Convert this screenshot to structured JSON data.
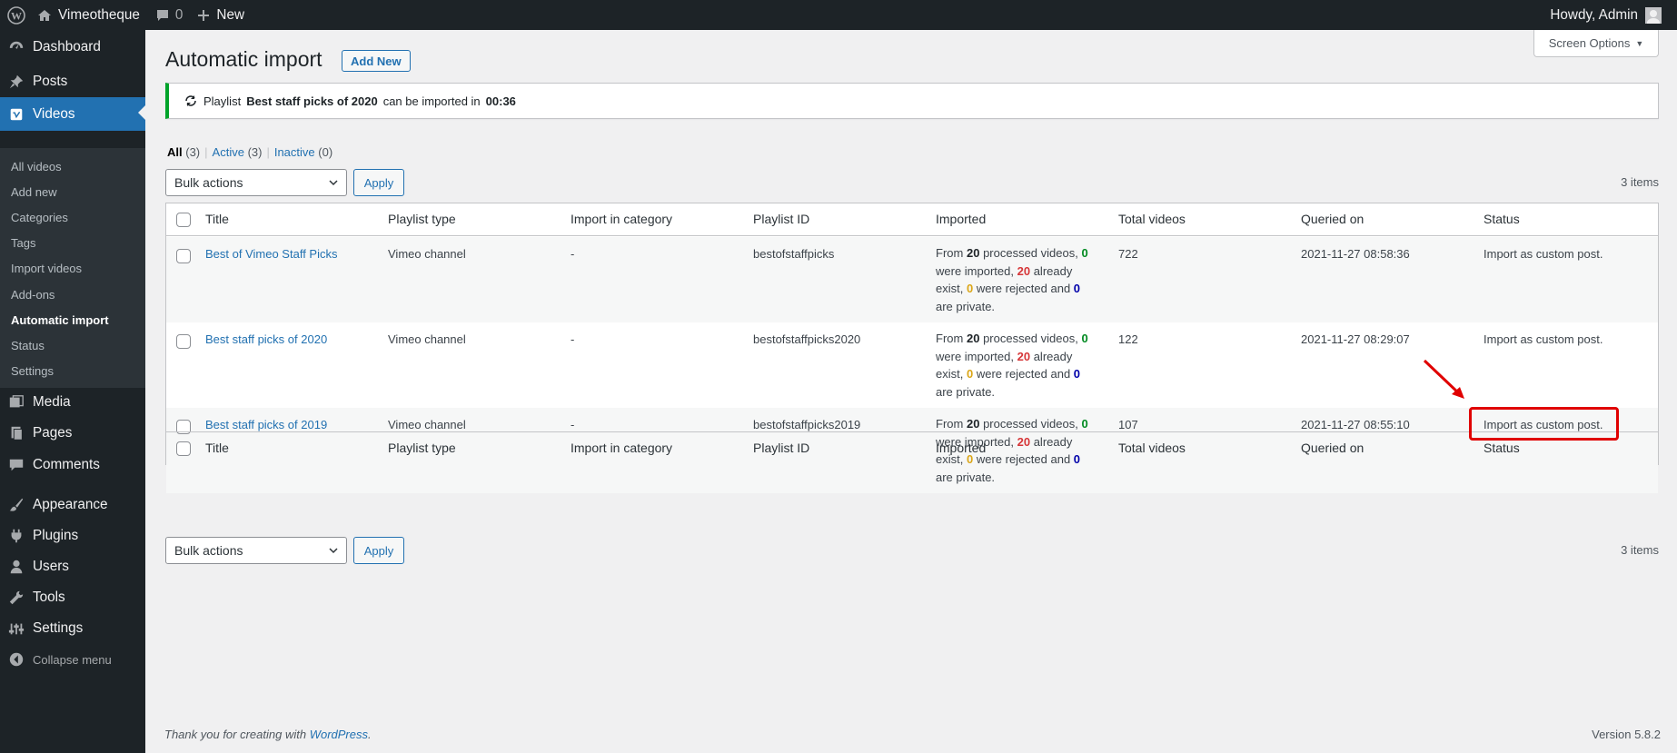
{
  "adminbar": {
    "site_name": "Vimeotheque",
    "comments_count": "0",
    "new_label": "New",
    "howdy": "Howdy, Admin"
  },
  "sidebar": {
    "items": [
      {
        "label": "Dashboard",
        "icon": "dashboard-icon"
      },
      {
        "label": "Posts",
        "icon": "pin-icon"
      },
      {
        "label": "Videos",
        "icon": "vimeo-icon"
      },
      {
        "label": "Media",
        "icon": "media-icon"
      },
      {
        "label": "Pages",
        "icon": "pages-icon"
      },
      {
        "label": "Comments",
        "icon": "comment-icon"
      },
      {
        "label": "Appearance",
        "icon": "brush-icon"
      },
      {
        "label": "Plugins",
        "icon": "plug-icon"
      },
      {
        "label": "Users",
        "icon": "user-icon"
      },
      {
        "label": "Tools",
        "icon": "wrench-icon"
      },
      {
        "label": "Settings",
        "icon": "settings-icon"
      }
    ],
    "submenu": [
      "All videos",
      "Add new",
      "Categories",
      "Tags",
      "Import videos",
      "Add-ons",
      "Automatic import",
      "Status",
      "Settings"
    ],
    "collapse_label": "Collapse menu"
  },
  "screen_options": "Screen Options",
  "page": {
    "title": "Automatic import",
    "add_new": "Add New"
  },
  "notice": {
    "prefix": "Playlist",
    "playlist": "Best staff picks of 2020",
    "middle": "can be imported in",
    "time": "00:36"
  },
  "filters": {
    "all": "All",
    "all_count": "(3)",
    "active": "Active",
    "active_count": "(3)",
    "inactive": "Inactive",
    "inactive_count": "(0)"
  },
  "bulk": {
    "select_label": "Bulk actions",
    "apply": "Apply",
    "items_count": "3 items"
  },
  "table": {
    "columns": [
      "Title",
      "Playlist type",
      "Import in category",
      "Playlist ID",
      "Imported",
      "Total videos",
      "Queried on",
      "Status"
    ],
    "rows": [
      {
        "title": "Best of Vimeo Staff Picks",
        "type": "Vimeo channel",
        "category": "-",
        "playlist_id": "bestofstaffpicks",
        "imported": {
          "t1": "From",
          "processed": "20",
          "t2": "processed videos,",
          "imported": "0",
          "t3": "were imported,",
          "exist": "20",
          "t4": "already exist,",
          "rejected": "0",
          "t5": "were rejected and",
          "private": "0",
          "t6": "are private."
        },
        "total": "722",
        "queried": "2021-11-27 08:58:36",
        "status": "Import as custom post."
      },
      {
        "title": "Best staff picks of 2020",
        "type": "Vimeo channel",
        "category": "-",
        "playlist_id": "bestofstaffpicks2020",
        "imported": {
          "t1": "From",
          "processed": "20",
          "t2": "processed videos,",
          "imported": "0",
          "t3": "were imported,",
          "exist": "20",
          "t4": "already exist,",
          "rejected": "0",
          "t5": "were rejected and",
          "private": "0",
          "t6": "are private."
        },
        "total": "122",
        "queried": "2021-11-27 08:29:07",
        "status": "Import as custom post."
      },
      {
        "title": "Best staff picks of 2019",
        "type": "Vimeo channel",
        "category": "-",
        "playlist_id": "bestofstaffpicks2019",
        "imported": {
          "t1": "From",
          "processed": "20",
          "t2": "processed videos,",
          "imported": "0",
          "t3": "were imported,",
          "exist": "20",
          "t4": "already exist,",
          "rejected": "0",
          "t5": "were rejected and",
          "private": "0",
          "t6": "are private."
        },
        "total": "107",
        "queried": "2021-11-27 08:55:10",
        "status": "Import as custom post."
      }
    ]
  },
  "footer": {
    "thanks": "Thank you for creating with",
    "link": "WordPress",
    "version": "Version 5.8.2"
  },
  "colors": {
    "accent": "#2271b1",
    "notice_border": "#00a32a",
    "highlight": "#e00000"
  }
}
